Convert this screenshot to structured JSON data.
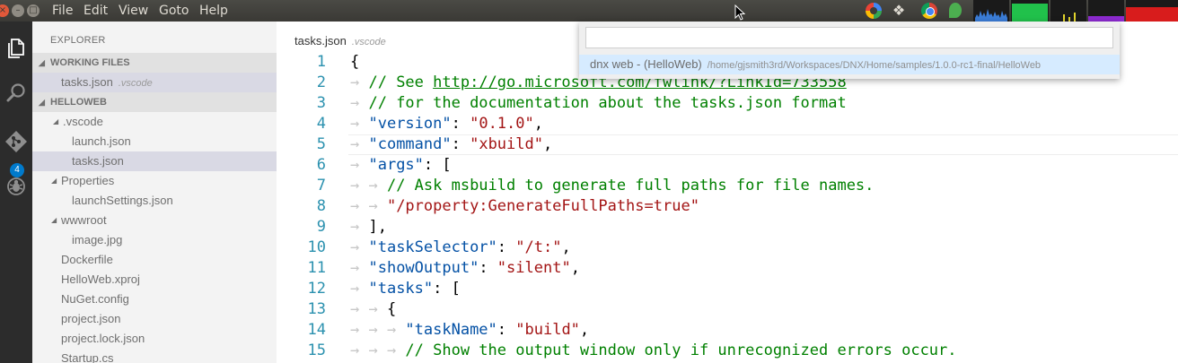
{
  "window": {
    "close_glyph": "×",
    "min_glyph": "–",
    "max_glyph": "□"
  },
  "menu": {
    "file": "File",
    "edit": "Edit",
    "view": "View",
    "goto": "Goto",
    "help": "Help"
  },
  "activity": {
    "git_badge": "4"
  },
  "sidebar": {
    "title": "EXPLORER",
    "working_files_header": "WORKING FILES",
    "working_files": [
      {
        "name": "tasks.json",
        "folder": ".vscode"
      }
    ],
    "project_header": "HELLOWEB",
    "tree": [
      {
        "label": ".vscode"
      },
      {
        "label": "launch.json"
      },
      {
        "label": "tasks.json"
      },
      {
        "label": "Properties"
      },
      {
        "label": "launchSettings.json"
      },
      {
        "label": "wwwroot"
      },
      {
        "label": "image.jpg"
      },
      {
        "label": "Dockerfile"
      },
      {
        "label": "HelloWeb.xproj"
      },
      {
        "label": "NuGet.config"
      },
      {
        "label": "project.json"
      },
      {
        "label": "project.lock.json"
      },
      {
        "label": "Startup.cs"
      }
    ]
  },
  "editor": {
    "file_name": "tasks.json",
    "file_folder": ".vscode",
    "lines": [
      {
        "num": "1",
        "parts": [
          {
            "t": "{",
            "c": "p"
          }
        ]
      },
      {
        "num": "2",
        "parts": [
          {
            "t": "→ ",
            "c": "ws"
          },
          {
            "t": "// See ",
            "c": "com"
          },
          {
            "t": "http://go.microsoft.com/fwlink/?LinkId=733558",
            "c": "link"
          }
        ]
      },
      {
        "num": "3",
        "parts": [
          {
            "t": "→ ",
            "c": "ws"
          },
          {
            "t": "// for the documentation about the tasks.json format",
            "c": "com"
          }
        ]
      },
      {
        "num": "4",
        "parts": [
          {
            "t": "→ ",
            "c": "ws"
          },
          {
            "t": "\"version\"",
            "c": "key"
          },
          {
            "t": ": ",
            "c": "p"
          },
          {
            "t": "\"0.1.0\"",
            "c": "str"
          },
          {
            "t": ",",
            "c": "p"
          }
        ]
      },
      {
        "num": "5",
        "parts": [
          {
            "t": "→ ",
            "c": "ws"
          },
          {
            "t": "\"command\"",
            "c": "key"
          },
          {
            "t": ": ",
            "c": "p"
          },
          {
            "t": "\"xbuild\"",
            "c": "str"
          },
          {
            "t": ",",
            "c": "p"
          }
        ]
      },
      {
        "num": "6",
        "parts": [
          {
            "t": "→ ",
            "c": "ws"
          },
          {
            "t": "\"args\"",
            "c": "key"
          },
          {
            "t": ": [",
            "c": "p"
          }
        ]
      },
      {
        "num": "7",
        "parts": [
          {
            "t": "→ → ",
            "c": "ws"
          },
          {
            "t": "// Ask msbuild to generate full paths for file names.",
            "c": "com"
          }
        ]
      },
      {
        "num": "8",
        "parts": [
          {
            "t": "→ → ",
            "c": "ws"
          },
          {
            "t": "\"/property:GenerateFullPaths=true\"",
            "c": "str"
          }
        ]
      },
      {
        "num": "9",
        "parts": [
          {
            "t": "→ ",
            "c": "ws"
          },
          {
            "t": "],",
            "c": "p"
          }
        ]
      },
      {
        "num": "10",
        "parts": [
          {
            "t": "→ ",
            "c": "ws"
          },
          {
            "t": "\"taskSelector\"",
            "c": "key"
          },
          {
            "t": ": ",
            "c": "p"
          },
          {
            "t": "\"/t:\"",
            "c": "str"
          },
          {
            "t": ",",
            "c": "p"
          }
        ]
      },
      {
        "num": "11",
        "parts": [
          {
            "t": "→ ",
            "c": "ws"
          },
          {
            "t": "\"showOutput\"",
            "c": "key"
          },
          {
            "t": ": ",
            "c": "p"
          },
          {
            "t": "\"silent\"",
            "c": "str"
          },
          {
            "t": ",",
            "c": "p"
          }
        ]
      },
      {
        "num": "12",
        "parts": [
          {
            "t": "→ ",
            "c": "ws"
          },
          {
            "t": "\"tasks\"",
            "c": "key"
          },
          {
            "t": ": [",
            "c": "p"
          }
        ]
      },
      {
        "num": "13",
        "parts": [
          {
            "t": "→ → ",
            "c": "ws"
          },
          {
            "t": "{",
            "c": "p"
          }
        ]
      },
      {
        "num": "14",
        "parts": [
          {
            "t": "→ → → ",
            "c": "ws"
          },
          {
            "t": "\"taskName\"",
            "c": "key"
          },
          {
            "t": ": ",
            "c": "p"
          },
          {
            "t": "\"build\"",
            "c": "str"
          },
          {
            "t": ",",
            "c": "p"
          }
        ]
      },
      {
        "num": "15",
        "parts": [
          {
            "t": "→ → → ",
            "c": "ws"
          },
          {
            "t": "// Show the output window only if unrecognized errors occur.",
            "c": "com"
          }
        ]
      }
    ]
  },
  "quick_open": {
    "input_value": "",
    "item_label": "dnx web - (HelloWeb)",
    "item_path": "/home/gjsmith3rd/Workspaces/DNX/Home/samples/1.0.0-rc1-final/HelloWeb"
  },
  "tray": {
    "dropbox_glyph": "❖"
  },
  "colors": {
    "accent": "#007acc",
    "activity_bar": "#2c2c2c",
    "sidebar_bg": "#f3f3f3",
    "selection": "#d9d9e4",
    "keyword": "#0451a5",
    "string": "#a31515",
    "comment": "#008000",
    "line_number": "#2b91af"
  }
}
